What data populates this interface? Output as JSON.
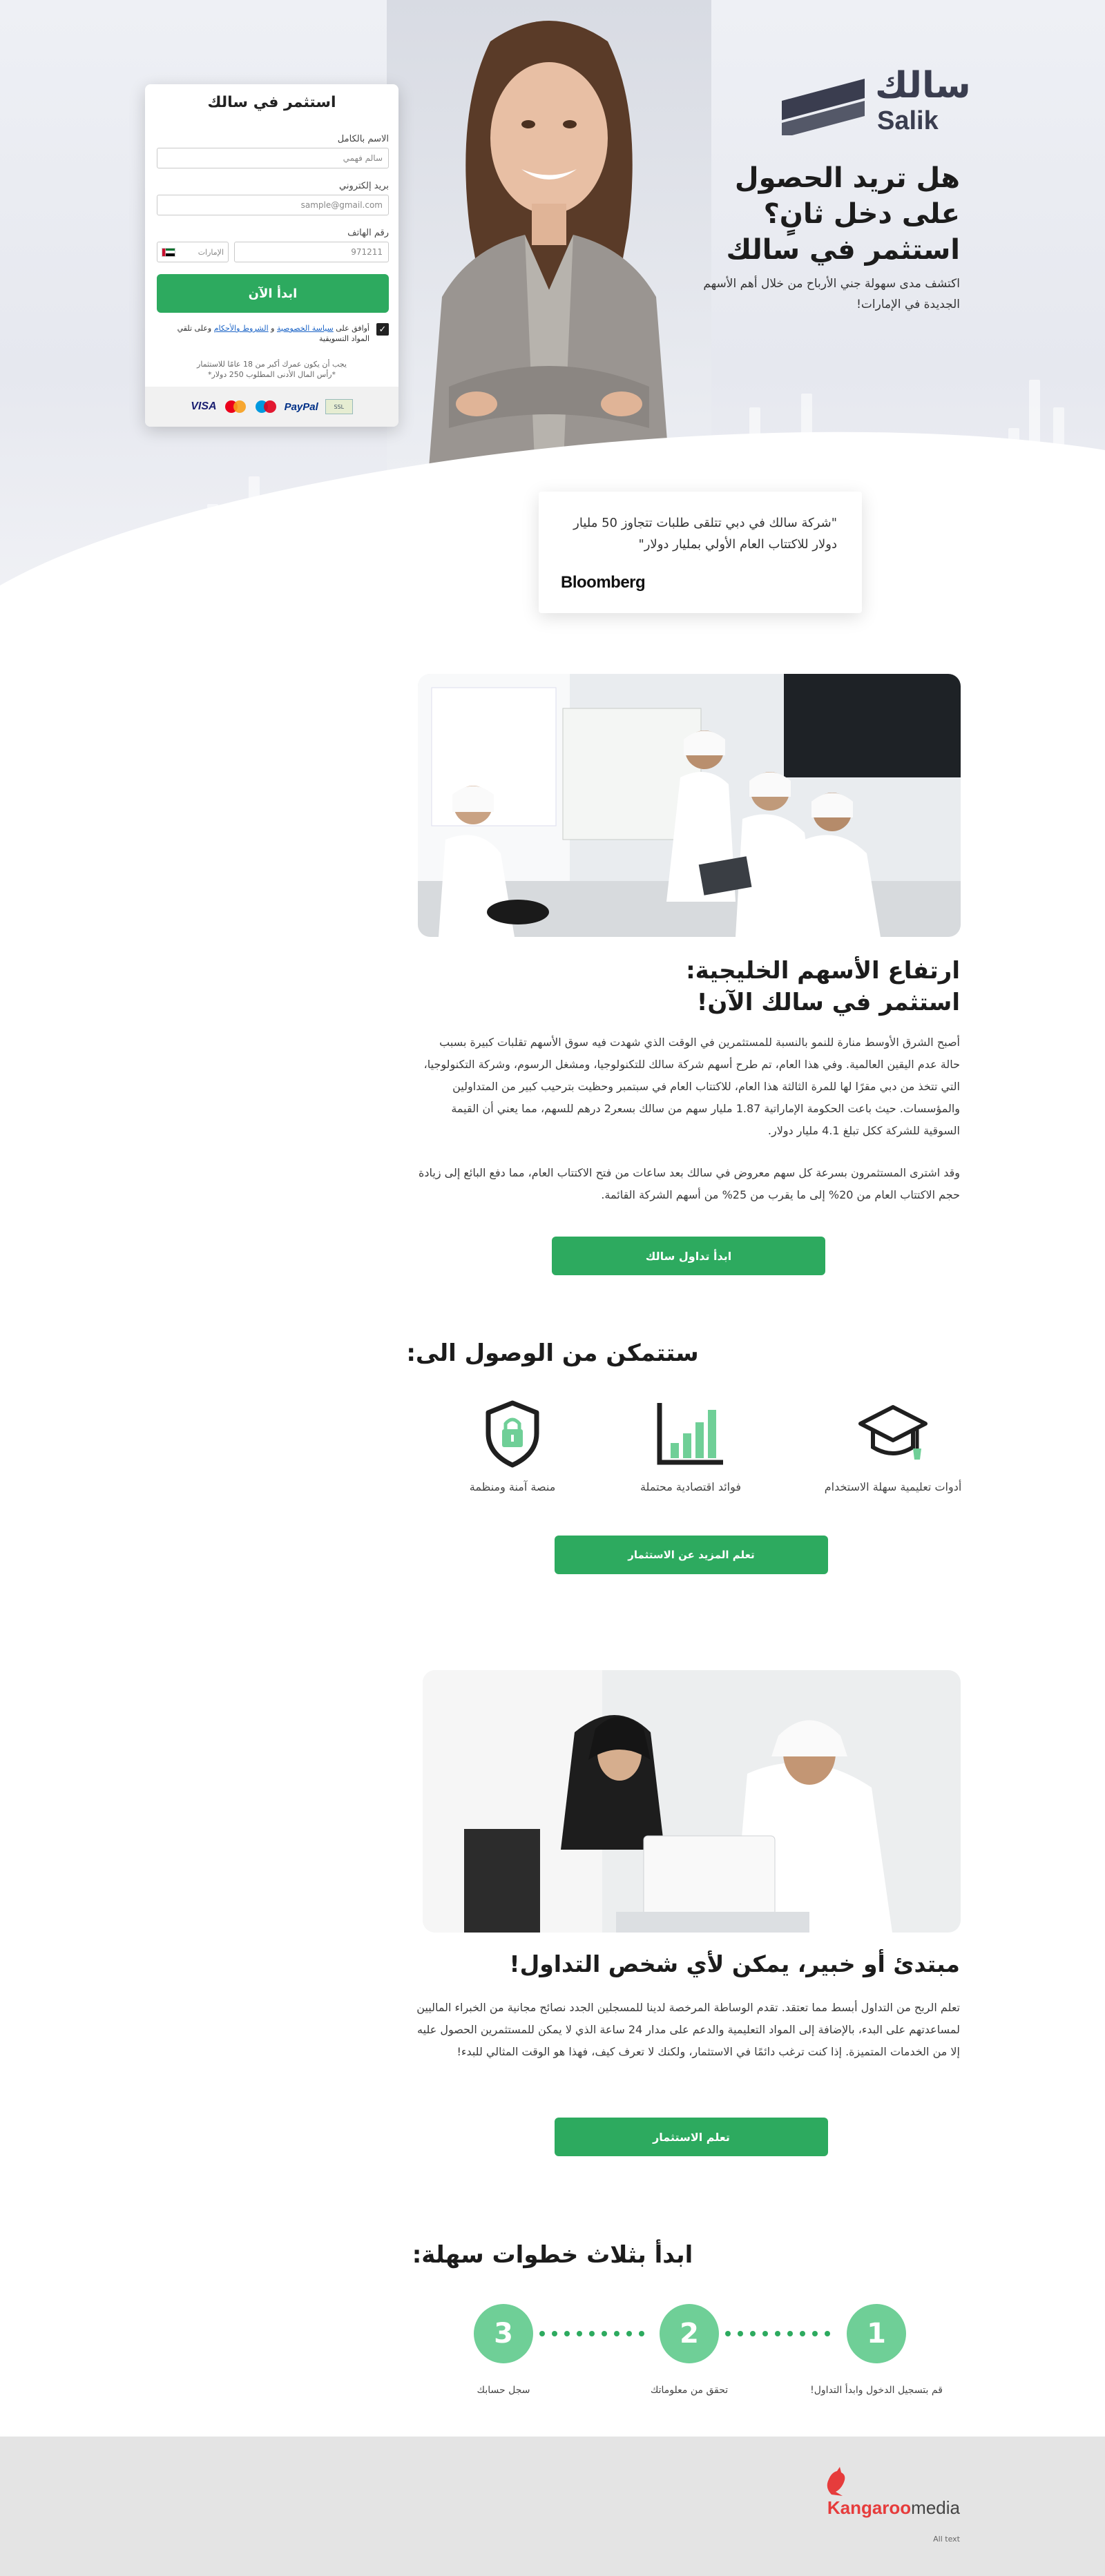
{
  "brand": {
    "name_ar": "سالك",
    "name_en": "Salik"
  },
  "hero": {
    "title_lines": [
      "هل تريد الحصول",
      "على دخل ثانٍ؟",
      "استثمر في سالك"
    ],
    "subtitle": "اكتشف مدى سهولة جني الأرباح من خلال أهم الأسهم الجديدة في الإمارات!"
  },
  "form": {
    "title": "استثمر في سالك",
    "name_label": "الاسم بالكامل",
    "name_placeholder": "سالم فهمي",
    "email_label": "بريد إلكتروني",
    "email_placeholder": "sample@gmail.com",
    "phone_label": "رقم الهاتف",
    "phone_placeholder": "971211",
    "country_code": "الإمارات",
    "submit_label": "ابدأ الآن",
    "agree_prefix": "أوافق على",
    "agree_link1": "سياسة الخصوصية",
    "agree_and": "و",
    "agree_link2": "الشروط والأحكام",
    "agree_suffix": "وعلى تلقي المواد التسويقية",
    "note_line1": "يجب أن يكون عمرك أكبر من 18 عامًا للاستثمار",
    "note_line2": "*رأس المال الأدنى المطلوب 250 دولار*",
    "payments": [
      "VISA",
      "PayPal"
    ]
  },
  "quote": {
    "text": "\"شركة سالك في دبي تتلقى طلبات تتجاوز 50 مليار دولار للاكتتاب العام الأولي بمليار دولار\"",
    "source": "Bloomberg"
  },
  "section1": {
    "title_line1": "ارتفاع الأسهم الخليجية:",
    "title_line2": "استثمر في سالك الآن!",
    "para1": "أصبح الشرق الأوسط منارة للنمو بالنسبة للمستثمرين في الوقت الذي شهدت فيه سوق الأسهم تقلبات كبيرة بسبب حالة عدم اليقين العالمية. وفي هذا العام، تم طرح أسهم شركة سالك للتكنولوجيا، ومشغل الرسوم، وشركة التكنولوجيا، التي تتخذ من دبي مقرًا لها للمرة الثالثة هذا العام، للاكتتاب العام في سبتمبر وحظيت بترحيب كبير من المتداولين والمؤسسات. حيث باعت الحكومة الإماراتية 1.87 مليار سهم من سالك بسعر2 درهم للسهم، مما يعني أن القيمة السوقية للشركة ككل تبلغ 4.1 مليار دولار.",
    "para2": "وقد اشترى المستثمرون بسرعة كل سهم معروض في سالك بعد ساعات من فتح الاكتتاب العام، مما دفع البائع إلى زيادة حجم الاكتتاب العام من 20% إلى ما يقرب من 25% من أسهم الشركة القائمة.",
    "button": "ابدأ تداول سالك"
  },
  "features": {
    "title": "ستتمكن من الوصول الى:",
    "items": [
      {
        "label": "أدوات تعليمية سهلة الاستخدام",
        "icon": "graduation-cap-icon"
      },
      {
        "label": "فوائد اقتصادية محتملة",
        "icon": "bar-chart-icon"
      },
      {
        "label": "منصة آمنة ومنظمة",
        "icon": "shield-lock-icon"
      }
    ],
    "button": "تعلم المزيد عن الاستثمار"
  },
  "section2": {
    "title": "مبتدئ أو خبير، يمكن لأي شخص التداول!",
    "para": "تعلم الربح من التداول أبسط مما تعتقد. تقدم الوساطة المرخصة لدينا للمسجلين الجدد نصائح مجانية من الخبراء الماليين لمساعدتهم على البدء، بالإضافة إلى المواد التعليمية والدعم على مدار 24 ساعة الذي لا يمكن للمستثمرين الحصول عليه إلا من الخدمات المتميزة. إذا كنت ترغب دائمًا في الاستثمار، ولكنك لا تعرف كيف، فهذا هو الوقت المثالي للبدء!",
    "button": "تعلم الاستثمار"
  },
  "steps": {
    "title": "ابدأ بثلاث خطوات سهلة:",
    "items": [
      {
        "num": "1",
        "label": "قم بتسجيل الدخول وابدأ التداول!"
      },
      {
        "num": "2",
        "label": "تحقق من معلوماتك"
      },
      {
        "num": "3",
        "label": "سجل حسابك"
      }
    ]
  },
  "footer": {
    "brand_part1": "Kangaroo",
    "brand_part2": "media",
    "copyright": "All text"
  },
  "colors": {
    "accent_green": "#2daa5f",
    "step_green": "#6fcf97",
    "logo_slate": "#3a3d4f"
  }
}
